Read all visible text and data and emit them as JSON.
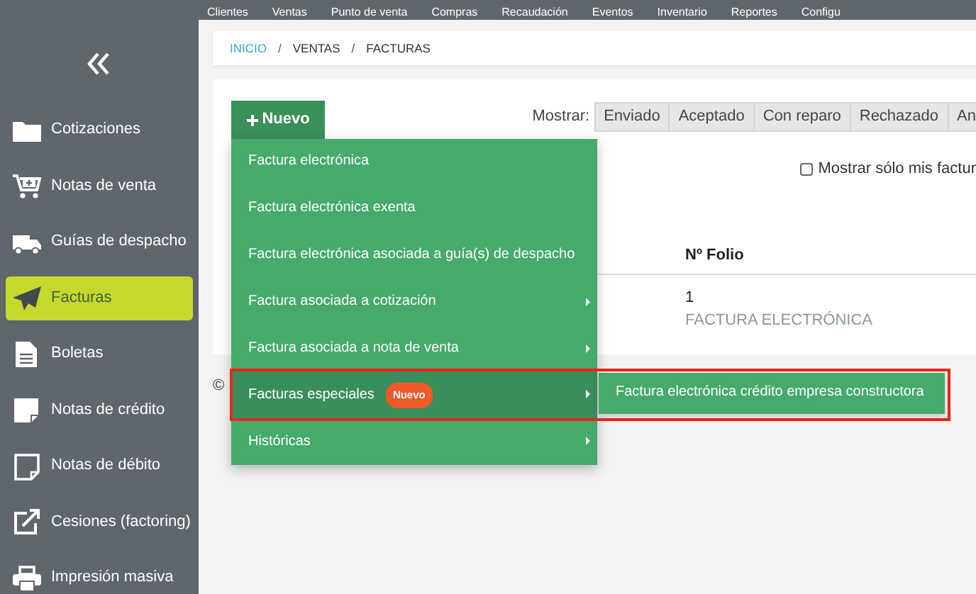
{
  "top_nav": {
    "items": [
      "Clientes",
      "Ventas",
      "Punto de venta",
      "Compras",
      "Recaudación",
      "Eventos",
      "Inventario",
      "Reportes",
      "Configu"
    ]
  },
  "sidebar": {
    "items": [
      {
        "label": "Cotizaciones",
        "selected": false
      },
      {
        "label": "Notas de venta",
        "selected": false
      },
      {
        "label": "Guías de despacho",
        "selected": false
      },
      {
        "label": "Facturas",
        "selected": true
      },
      {
        "label": "Boletas",
        "selected": false
      },
      {
        "label": "Notas de crédito",
        "selected": false
      },
      {
        "label": "Notas de débito",
        "selected": false
      },
      {
        "label": "Cesiones (factoring)",
        "selected": false
      },
      {
        "label": "Impresión masiva",
        "selected": false
      }
    ]
  },
  "breadcrumb": {
    "separators": [
      "/",
      "/"
    ],
    "items": [
      {
        "label": "INICIO",
        "link": true
      },
      {
        "label": "VENTAS",
        "link": false
      },
      {
        "label": "FACTURAS",
        "link": false
      }
    ]
  },
  "new_button": {
    "label": "Nuevo",
    "expanded": true
  },
  "new_menu": [
    {
      "label": "Factura electrónica",
      "has_submenu": false,
      "selected": false
    },
    {
      "label": "Factura electrónica exenta",
      "has_submenu": false,
      "selected": false
    },
    {
      "label": "Factura electrónica asociada a guía(s) de despacho",
      "has_submenu": false,
      "selected": false
    },
    {
      "label": "Factura asociada a cotización",
      "has_submenu": true,
      "selected": false
    },
    {
      "label": "Factura asociada a nota de venta",
      "has_submenu": true,
      "selected": false
    },
    {
      "label": "Facturas especiales",
      "badge": "Nuevo",
      "has_submenu": true,
      "selected": true,
      "annotated": true,
      "children": [
        {
          "label": "Factura electrónica crédito empresa constructora"
        }
      ]
    },
    {
      "label": "Históricas",
      "has_submenu": true,
      "selected": false
    }
  ],
  "filter": {
    "label": "Mostrar:",
    "tabs": [
      {
        "label": "Enviado",
        "selected": false
      },
      {
        "label": "Aceptado",
        "selected": false
      },
      {
        "label": "Con reparo",
        "selected": false
      },
      {
        "label": "Rechazado",
        "selected": false
      },
      {
        "label": "An",
        "selected": false
      }
    ]
  },
  "only_mine": {
    "label": "Mostrar sólo mis factur",
    "checked": false
  },
  "table": {
    "columns": [
      "Nº Folio"
    ],
    "rows": [
      {
        "folio": "1",
        "type": "FACTURA ELECTRÓNICA"
      }
    ]
  },
  "footer": "©"
}
